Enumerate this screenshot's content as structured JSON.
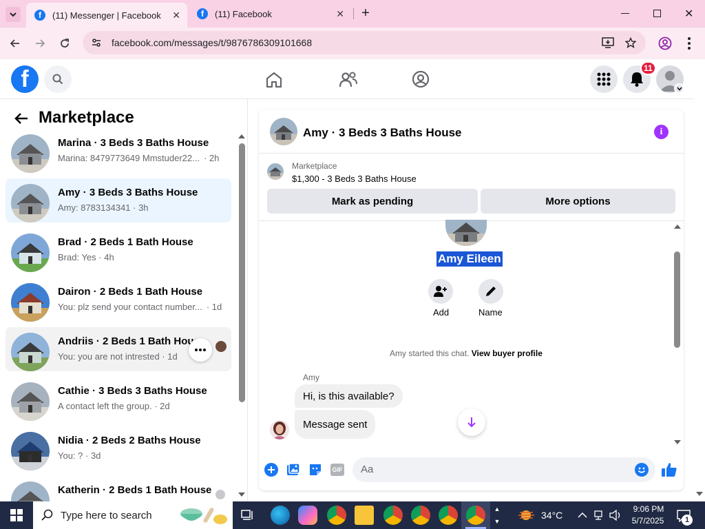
{
  "browser": {
    "tabs": [
      {
        "title": "(11) Messenger | Facebook",
        "active": true
      },
      {
        "title": "(11) Facebook",
        "active": false
      }
    ],
    "new_tab": "+",
    "url": "facebook.com/messages/t/9876786309101668"
  },
  "fb": {
    "logo": "f",
    "notification_count": "11"
  },
  "marketplace": {
    "title": "Marketplace",
    "conversations": [
      {
        "title": "Marina · 3 Beds 3 Baths House",
        "subtitle": "Marina: 8479773649 Mmstuder22...",
        "time": "· 2h",
        "state": "normal"
      },
      {
        "title": "Amy · 3 Beds 3 Baths House",
        "subtitle": "Amy: 8783134341 · 3h",
        "time": "",
        "state": "active"
      },
      {
        "title": "Brad · 2 Beds 1 Bath House",
        "subtitle": "Brad: Yes · 4h",
        "time": "",
        "state": "normal"
      },
      {
        "title": "Dairon · 2 Beds 1 Bath House",
        "subtitle": "You: plz send your contact number...",
        "time": "· 1d",
        "state": "normal"
      },
      {
        "title": "Andriis · 2 Beds 1 Bath House",
        "subtitle": "You: you are not intrested · 1d",
        "time": "",
        "state": "hover"
      },
      {
        "title": "Cathie · 3 Beds 3 Baths House",
        "subtitle": "A contact left the group. · 2d",
        "time": "",
        "state": "normal"
      },
      {
        "title": "Nidia · 2 Beds 2 Baths House",
        "subtitle": "You: ? · 3d",
        "time": "",
        "state": "normal"
      },
      {
        "title": "Katherin · 2 Beds 1 Bath House",
        "subtitle": "",
        "time": "",
        "state": "normal"
      }
    ]
  },
  "chat": {
    "header_title": "Amy · 3 Beds 3 Baths House",
    "listing_source": "Marketplace",
    "listing_price_title": "$1,300 - 3 Beds 3 Baths House",
    "mark_pending": "Mark as pending",
    "more_options": "More options",
    "contact_name": "Amy Eileen",
    "add_label": "Add",
    "name_label": "Name",
    "started_text": "Amy started this chat.",
    "view_buyer_profile": "View buyer profile",
    "sender_name": "Amy",
    "messages": [
      {
        "text": "Hi, is this available?"
      },
      {
        "text": "Message sent"
      }
    ],
    "composer_placeholder": "Aa"
  },
  "taskbar": {
    "search_placeholder": "Type here to search",
    "weather": "34°C",
    "time": "9:06 PM",
    "date": "5/7/2025",
    "notification_badge": "1"
  },
  "colors": {
    "facebook_blue": "#1877f2",
    "messenger_purple": "#a033ff",
    "active_conv_bg": "#ebf5ff",
    "notification_red": "#e41e3f",
    "selection_blue": "#1a56d6",
    "tab_strip": "#f9d2e6",
    "taskbar": "#202a44"
  }
}
